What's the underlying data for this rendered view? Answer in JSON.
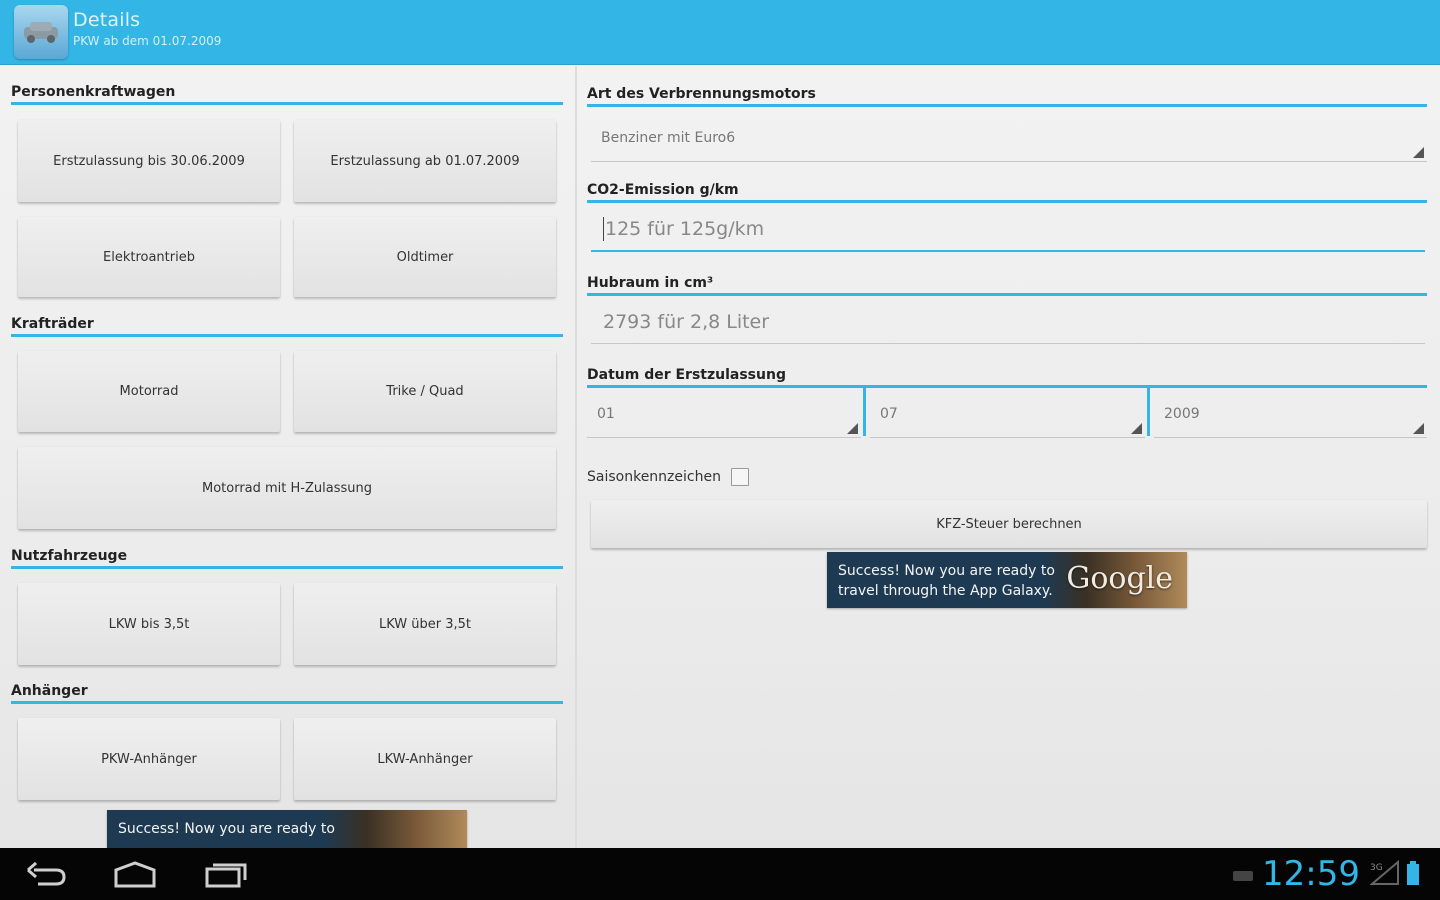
{
  "actionbar": {
    "title": "Details",
    "subtitle": "PKW ab dem 01.07.2009",
    "accent": "#33b5e5"
  },
  "left": {
    "sections": [
      {
        "header": "Personenkraftwagen"
      },
      {
        "header": "Krafträder"
      },
      {
        "header": "Nutzfahrzeuge"
      },
      {
        "header": "Anhänger"
      }
    ],
    "buttons": {
      "pkw_bis": "Erstzulassung bis 30.06.2009",
      "pkw_ab": "Erstzulassung ab 01.07.2009",
      "elektro": "Elektroantrieb",
      "oldtimer": "Oldtimer",
      "motorrad": "Motorrad",
      "trike": "Trike / Quad",
      "motorrad_h": "Motorrad mit H-Zulassung",
      "lkw_bis": "LKW bis 3,5t",
      "lkw_ueber": "LKW über 3,5t",
      "pkw_anh": "PKW-Anhänger",
      "lkw_anh": "LKW-Anhänger"
    },
    "ad_text_line1": "Success! Now you are ready to"
  },
  "right": {
    "engine_label": "Art des Verbrennungsmotors",
    "engine_value": "Benziner mit Euro6",
    "co2_label": "CO2-Emission g/km",
    "co2_placeholder": "125 für 125g/km",
    "hubraum_label": "Hubraum in cm³",
    "hubraum_placeholder": "2793 für 2,8 Liter",
    "date_label": "Datum der Erstzulassung",
    "date_day": "01",
    "date_month": "07",
    "date_year": "2009",
    "saison_label": "Saisonkennzeichen",
    "calc_button": "KFZ-Steuer berechnen",
    "ad_line1": "Success! Now you are ready to",
    "ad_line2": "travel through the App Galaxy.",
    "ad_brand": "Google"
  },
  "navbar": {
    "clock": "12:59",
    "signal_label": "3G"
  }
}
